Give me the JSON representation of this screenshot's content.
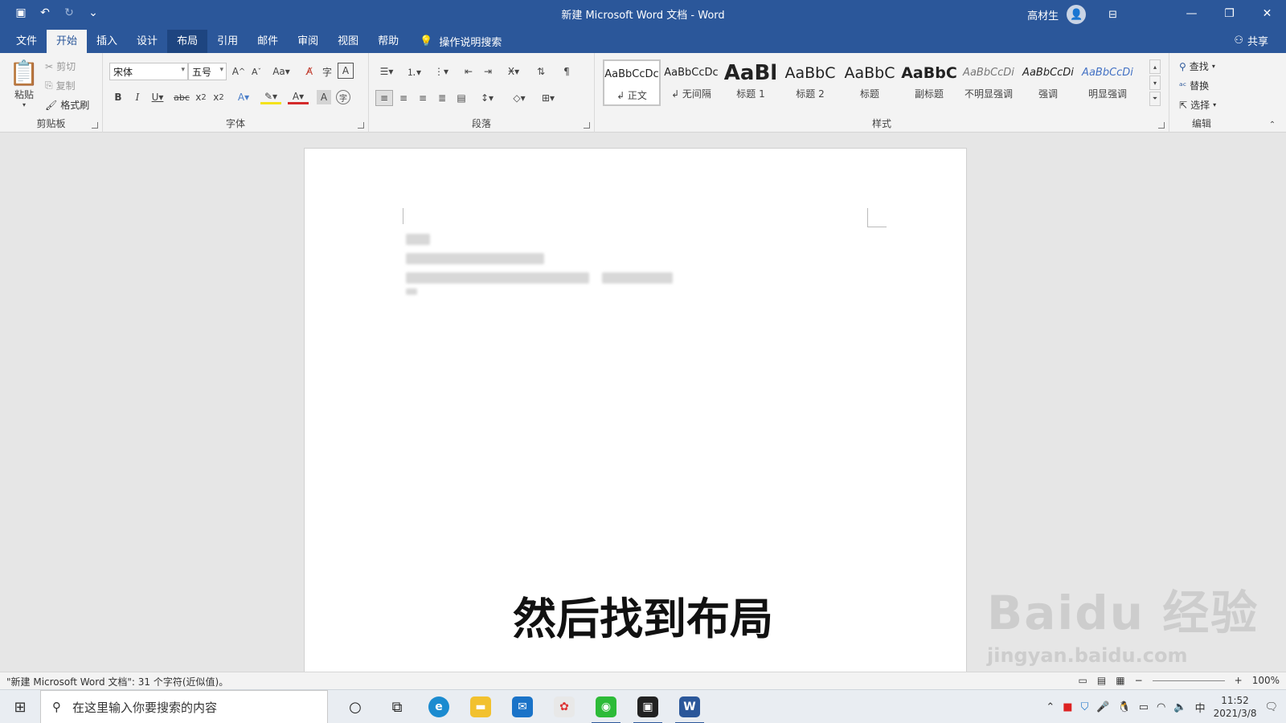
{
  "title_bar": {
    "title": "新建 Microsoft Word 文档 - Word",
    "user_name": "高材生",
    "qat": {
      "save_icon": "save-icon",
      "undo_icon": "undo-icon",
      "redo_icon": "redo-icon",
      "customize_icon": "customize-qat-icon"
    }
  },
  "tabs": [
    "文件",
    "开始",
    "插入",
    "设计",
    "布局",
    "引用",
    "邮件",
    "审阅",
    "视图",
    "帮助"
  ],
  "tell_me": "操作说明搜索",
  "share_label": "共享",
  "ribbon": {
    "clipboard": {
      "paste": "粘贴",
      "cut": "剪切",
      "copy": "复制",
      "format_painter": "格式刷",
      "label": "剪贴板"
    },
    "font": {
      "font_name": "宋体",
      "font_size": "五号",
      "label": "字体"
    },
    "paragraph": {
      "label": "段落"
    },
    "styles": {
      "label": "样式",
      "items": [
        {
          "sample": "AaBbCcDc",
          "name": "↲ 正文"
        },
        {
          "sample": "AaBbCcDc",
          "name": "↲ 无间隔"
        },
        {
          "sample": "AaBl",
          "name": "标题 1"
        },
        {
          "sample": "AaBbC",
          "name": "标题 2"
        },
        {
          "sample": "AaBbC",
          "name": "标题"
        },
        {
          "sample": "AaBbC",
          "name": "副标题"
        },
        {
          "sample": "AaBbCcDi",
          "name": "不明显强调"
        },
        {
          "sample": "AaBbCcDi",
          "name": "强调"
        },
        {
          "sample": "AaBbCcDi",
          "name": "明显强调"
        }
      ]
    },
    "editing": {
      "find": "查找",
      "replace": "替换",
      "select": "选择",
      "label": "编辑"
    }
  },
  "document": {
    "caption": "然后找到布局",
    "watermark_main": "Baidu 经验",
    "watermark_sub": "jingyan.baidu.com"
  },
  "status_bar": {
    "word_count": "\"新建 Microsoft Word 文档\": 31 个字符(近似值)。",
    "zoom": "100%"
  },
  "taskbar": {
    "search_placeholder": "在这里输入你要搜索的内容",
    "time": "11:52",
    "date": "2021/3/8",
    "ime": "中"
  }
}
